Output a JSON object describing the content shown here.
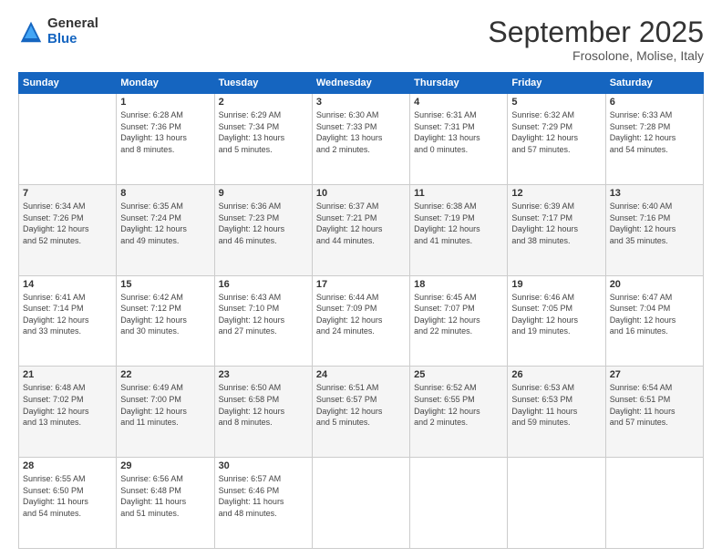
{
  "logo": {
    "general": "General",
    "blue": "Blue"
  },
  "header": {
    "month": "September 2025",
    "location": "Frosolone, Molise, Italy"
  },
  "weekdays": [
    "Sunday",
    "Monday",
    "Tuesday",
    "Wednesday",
    "Thursday",
    "Friday",
    "Saturday"
  ],
  "weeks": [
    [
      {
        "day": "",
        "info": ""
      },
      {
        "day": "1",
        "info": "Sunrise: 6:28 AM\nSunset: 7:36 PM\nDaylight: 13 hours\nand 8 minutes."
      },
      {
        "day": "2",
        "info": "Sunrise: 6:29 AM\nSunset: 7:34 PM\nDaylight: 13 hours\nand 5 minutes."
      },
      {
        "day": "3",
        "info": "Sunrise: 6:30 AM\nSunset: 7:33 PM\nDaylight: 13 hours\nand 2 minutes."
      },
      {
        "day": "4",
        "info": "Sunrise: 6:31 AM\nSunset: 7:31 PM\nDaylight: 13 hours\nand 0 minutes."
      },
      {
        "day": "5",
        "info": "Sunrise: 6:32 AM\nSunset: 7:29 PM\nDaylight: 12 hours\nand 57 minutes."
      },
      {
        "day": "6",
        "info": "Sunrise: 6:33 AM\nSunset: 7:28 PM\nDaylight: 12 hours\nand 54 minutes."
      }
    ],
    [
      {
        "day": "7",
        "info": "Sunrise: 6:34 AM\nSunset: 7:26 PM\nDaylight: 12 hours\nand 52 minutes."
      },
      {
        "day": "8",
        "info": "Sunrise: 6:35 AM\nSunset: 7:24 PM\nDaylight: 12 hours\nand 49 minutes."
      },
      {
        "day": "9",
        "info": "Sunrise: 6:36 AM\nSunset: 7:23 PM\nDaylight: 12 hours\nand 46 minutes."
      },
      {
        "day": "10",
        "info": "Sunrise: 6:37 AM\nSunset: 7:21 PM\nDaylight: 12 hours\nand 44 minutes."
      },
      {
        "day": "11",
        "info": "Sunrise: 6:38 AM\nSunset: 7:19 PM\nDaylight: 12 hours\nand 41 minutes."
      },
      {
        "day": "12",
        "info": "Sunrise: 6:39 AM\nSunset: 7:17 PM\nDaylight: 12 hours\nand 38 minutes."
      },
      {
        "day": "13",
        "info": "Sunrise: 6:40 AM\nSunset: 7:16 PM\nDaylight: 12 hours\nand 35 minutes."
      }
    ],
    [
      {
        "day": "14",
        "info": "Sunrise: 6:41 AM\nSunset: 7:14 PM\nDaylight: 12 hours\nand 33 minutes."
      },
      {
        "day": "15",
        "info": "Sunrise: 6:42 AM\nSunset: 7:12 PM\nDaylight: 12 hours\nand 30 minutes."
      },
      {
        "day": "16",
        "info": "Sunrise: 6:43 AM\nSunset: 7:10 PM\nDaylight: 12 hours\nand 27 minutes."
      },
      {
        "day": "17",
        "info": "Sunrise: 6:44 AM\nSunset: 7:09 PM\nDaylight: 12 hours\nand 24 minutes."
      },
      {
        "day": "18",
        "info": "Sunrise: 6:45 AM\nSunset: 7:07 PM\nDaylight: 12 hours\nand 22 minutes."
      },
      {
        "day": "19",
        "info": "Sunrise: 6:46 AM\nSunset: 7:05 PM\nDaylight: 12 hours\nand 19 minutes."
      },
      {
        "day": "20",
        "info": "Sunrise: 6:47 AM\nSunset: 7:04 PM\nDaylight: 12 hours\nand 16 minutes."
      }
    ],
    [
      {
        "day": "21",
        "info": "Sunrise: 6:48 AM\nSunset: 7:02 PM\nDaylight: 12 hours\nand 13 minutes."
      },
      {
        "day": "22",
        "info": "Sunrise: 6:49 AM\nSunset: 7:00 PM\nDaylight: 12 hours\nand 11 minutes."
      },
      {
        "day": "23",
        "info": "Sunrise: 6:50 AM\nSunset: 6:58 PM\nDaylight: 12 hours\nand 8 minutes."
      },
      {
        "day": "24",
        "info": "Sunrise: 6:51 AM\nSunset: 6:57 PM\nDaylight: 12 hours\nand 5 minutes."
      },
      {
        "day": "25",
        "info": "Sunrise: 6:52 AM\nSunset: 6:55 PM\nDaylight: 12 hours\nand 2 minutes."
      },
      {
        "day": "26",
        "info": "Sunrise: 6:53 AM\nSunset: 6:53 PM\nDaylight: 11 hours\nand 59 minutes."
      },
      {
        "day": "27",
        "info": "Sunrise: 6:54 AM\nSunset: 6:51 PM\nDaylight: 11 hours\nand 57 minutes."
      }
    ],
    [
      {
        "day": "28",
        "info": "Sunrise: 6:55 AM\nSunset: 6:50 PM\nDaylight: 11 hours\nand 54 minutes."
      },
      {
        "day": "29",
        "info": "Sunrise: 6:56 AM\nSunset: 6:48 PM\nDaylight: 11 hours\nand 51 minutes."
      },
      {
        "day": "30",
        "info": "Sunrise: 6:57 AM\nSunset: 6:46 PM\nDaylight: 11 hours\nand 48 minutes."
      },
      {
        "day": "",
        "info": ""
      },
      {
        "day": "",
        "info": ""
      },
      {
        "day": "",
        "info": ""
      },
      {
        "day": "",
        "info": ""
      }
    ]
  ]
}
